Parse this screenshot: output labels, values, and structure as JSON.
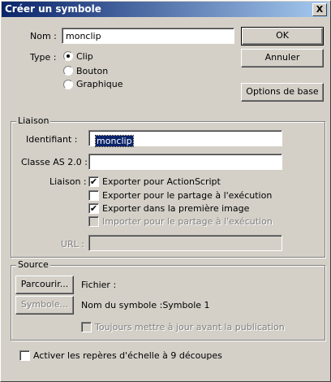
{
  "window": {
    "title": "Créer un symbole",
    "close_glyph": "X"
  },
  "nom": {
    "label": "Nom :",
    "value": "monclip"
  },
  "type": {
    "label": "Type :",
    "options": [
      {
        "label": "Clip",
        "selected": true
      },
      {
        "label": "Bouton",
        "selected": false
      },
      {
        "label": "Graphique",
        "selected": false
      }
    ]
  },
  "buttons": {
    "ok": "OK",
    "annuler": "Annuler",
    "options_de_base": "Options de base"
  },
  "liaison": {
    "legend": "Liaison",
    "identifiant_label": "Identifiant :",
    "identifiant_value": "monclip",
    "classe_label": "Classe AS 2.0 :",
    "classe_value": "",
    "liaison_label": "Liaison :",
    "checks": [
      {
        "label": "Exporter pour ActionScript",
        "checked": true,
        "enabled": true
      },
      {
        "label": "Exporter pour le partage à l'exécution",
        "checked": false,
        "enabled": true
      },
      {
        "label": "Exporter dans la première image",
        "checked": true,
        "enabled": true
      },
      {
        "label": "Importer pour le partage à l'exécution",
        "checked": false,
        "enabled": false
      }
    ],
    "url_label": "URL :",
    "url_value": ""
  },
  "source": {
    "legend": "Source",
    "parcourir": "Parcourir...",
    "fichier": "Fichier :",
    "symbole_button": "Symbole...",
    "nom_du_symbole": "Nom du symbole :Symbole 1",
    "toujours": "Toujours mettre à jour avant la publication"
  },
  "scale9": {
    "label": "Activer les repères d'échelle à 9 découpes",
    "checked": false
  }
}
